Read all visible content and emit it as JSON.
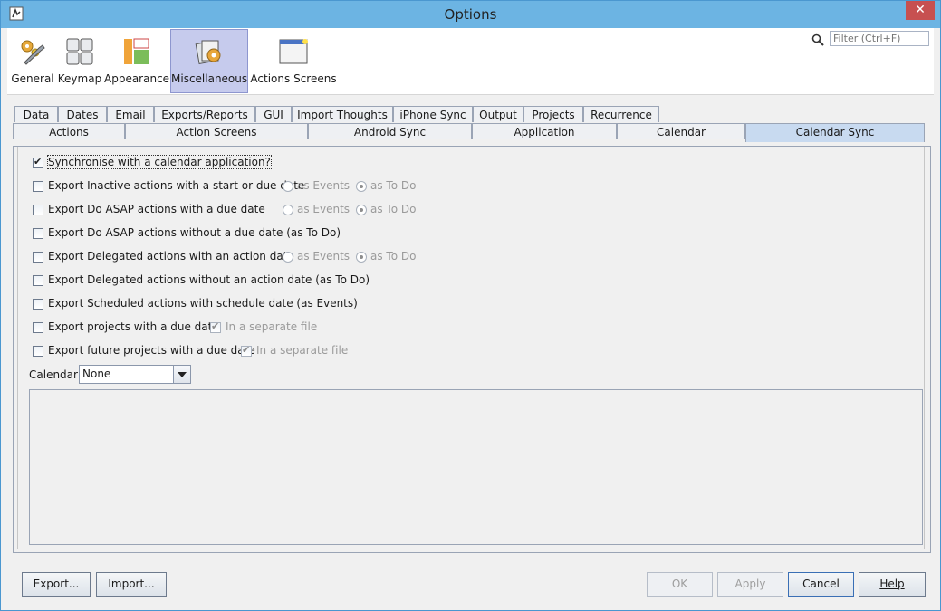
{
  "window": {
    "title": "Options",
    "close_glyph": "✕"
  },
  "toolbar": {
    "items": [
      {
        "label": "General",
        "icon": "gears-wrench-icon"
      },
      {
        "label": "Keymap",
        "icon": "keyboard-keys-icon"
      },
      {
        "label": "Appearance",
        "icon": "layout-icon"
      },
      {
        "label": "Miscellaneous",
        "icon": "misc-folder-icon",
        "selected": true
      },
      {
        "label": "Actions Screens",
        "icon": "window-screen-icon"
      }
    ],
    "filter_placeholder": "Filter (Ctrl+F)"
  },
  "tabs_row1": [
    "Data",
    "Dates",
    "Email",
    "Exports/Reports",
    "GUI",
    "Import Thoughts",
    "iPhone Sync",
    "Output",
    "Projects",
    "Recurrence"
  ],
  "tabs_row2": [
    "Actions",
    "Action Screens",
    "Android Sync",
    "Application",
    "Calendar",
    "Calendar Sync"
  ],
  "active_tab": "Calendar Sync",
  "options": [
    {
      "label": "Synchronise with a calendar application?",
      "checked": true
    },
    {
      "label": "Export Inactive actions with a start or due date",
      "checked": false,
      "radio_events": "as Events",
      "radio_todo": "as To Do"
    },
    {
      "label": "Export Do ASAP actions with a due date",
      "checked": false,
      "radio_events": "as Events",
      "radio_todo": "as To Do"
    },
    {
      "label": "Export Do ASAP actions without a due date (as To Do)",
      "checked": false
    },
    {
      "label": "Export Delegated actions with an action date",
      "checked": false,
      "radio_events": "as Events",
      "radio_todo": "as To Do"
    },
    {
      "label": "Export Delegated actions without an action date (as To Do)",
      "checked": false
    },
    {
      "label": "Export Scheduled actions with schedule date (as Events)",
      "checked": false
    },
    {
      "label": "Export projects with a due date",
      "checked": false,
      "separate": "In a separate file"
    },
    {
      "label": "Export future projects with a due date",
      "checked": false,
      "separate": "In a separate file"
    }
  ],
  "calendar": {
    "label": "Calendar",
    "value": "None"
  },
  "buttons": {
    "export": "Export...",
    "import": "Import...",
    "ok": "OK",
    "apply": "Apply",
    "cancel": "Cancel",
    "help": "Help"
  }
}
